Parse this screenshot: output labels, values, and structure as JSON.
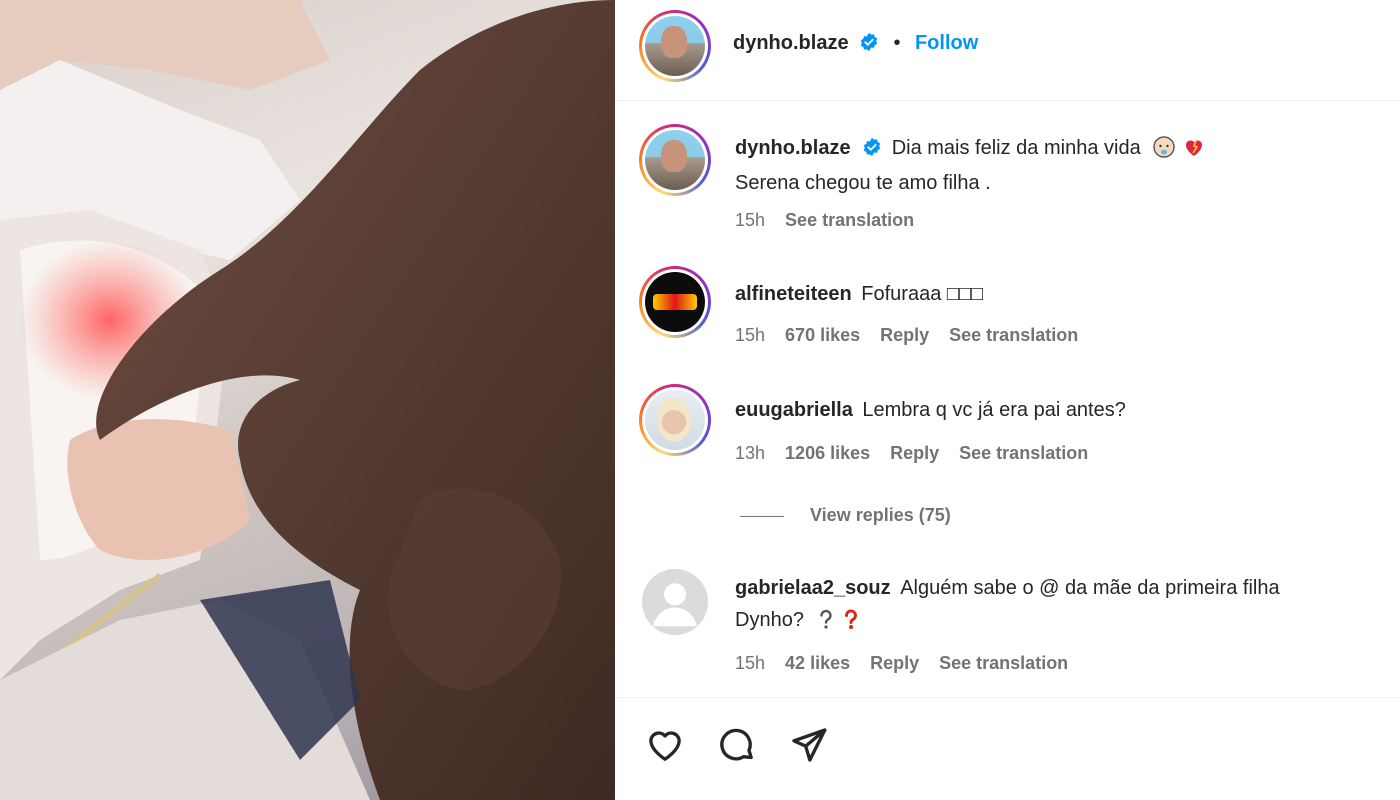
{
  "post": {
    "author": "dynho.blaze",
    "follow_label": "Follow",
    "separator": "•"
  },
  "caption": {
    "username": "dynho.blaze",
    "line1": "Dia mais feliz da minha vida",
    "line2": "Serena chegou te amo filha .",
    "time": "15h",
    "translate": "See translation"
  },
  "comments": [
    {
      "username": "alfineteiteen",
      "text": "Fofuraaa □□□",
      "time": "15h",
      "likes": "670 likes",
      "reply": "Reply",
      "translate": "See translation"
    },
    {
      "username": "euugabriella",
      "text": "Lembra q vc já era pai antes?",
      "time": "13h",
      "likes": "1206 likes",
      "reply": "Reply",
      "translate": "See translation",
      "view_replies": "View replies (75)"
    },
    {
      "username": "gabrielaa2_souz",
      "text_line1": "Alguém sabe o @ da mãe da primeira filha",
      "text_line2": "Dynho?",
      "time": "15h",
      "likes": "42 likes",
      "reply": "Reply",
      "translate": "See translation"
    }
  ],
  "colors": {
    "link": "#0095f6",
    "muted": "#737373",
    "text": "#262626",
    "divider": "#efefef"
  },
  "icons": [
    "verified-badge-icon",
    "heart-icon",
    "comment-icon",
    "share-icon",
    "baby-emoji",
    "heart-emoji",
    "question-mark-emoji"
  ]
}
